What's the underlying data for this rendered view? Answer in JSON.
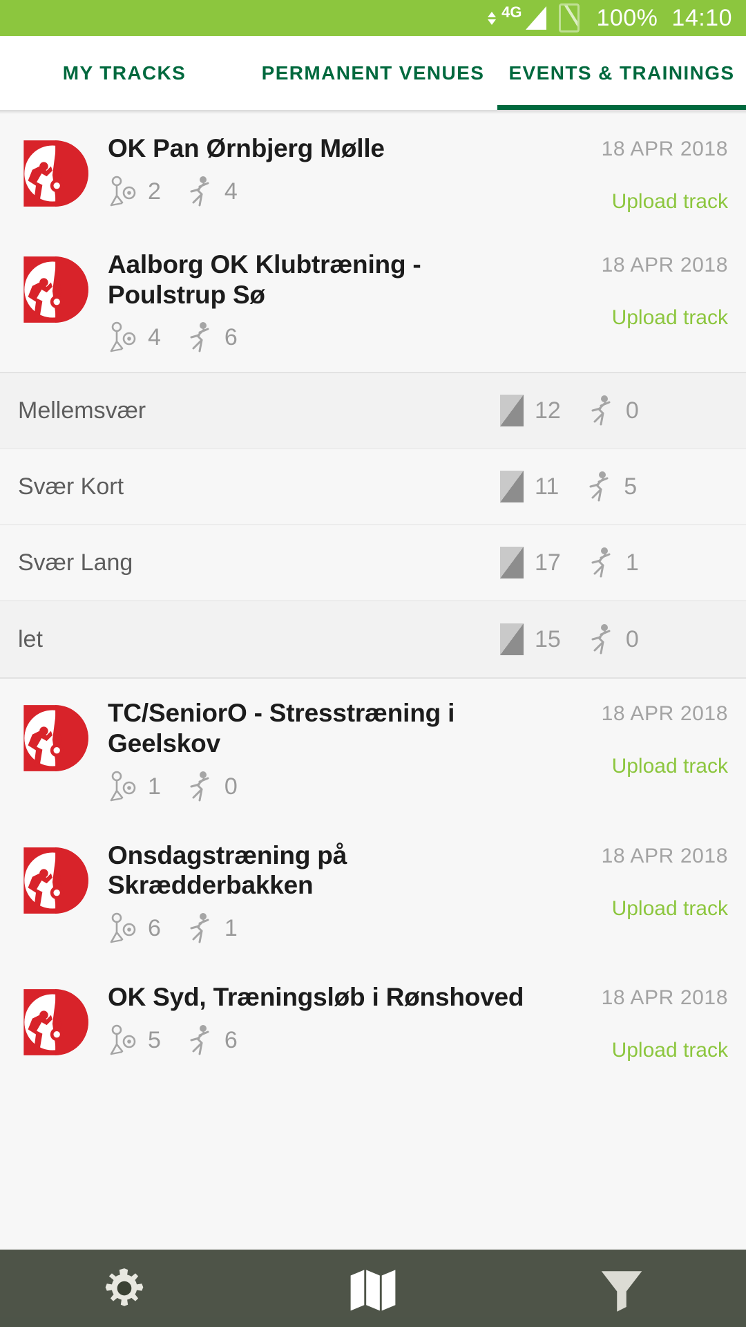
{
  "statusbar": {
    "network_label": "4G",
    "battery_percent": "100%",
    "time": "14:10",
    "background_color": "#8cc63e"
  },
  "tabs": [
    {
      "label": "MY TRACKS",
      "active": false
    },
    {
      "label": "PERMANENT VENUES",
      "active": false
    },
    {
      "label": "EVENTS & TRAININGS",
      "active": true
    }
  ],
  "theme": {
    "tab_color": "#00693e",
    "accent_green": "#8cc63e",
    "logo_red": "#d8232a",
    "muted_text": "#9a9a9a"
  },
  "upload_label": "Upload track",
  "events": [
    {
      "title": "OK Pan Ørnbjerg Mølle",
      "date": "18 APR 2018",
      "upload": "Upload track",
      "control_count": "2",
      "runner_count": "4"
    },
    {
      "title": "Aalborg OK Klubtræning - Poulstrup Sø",
      "date": "18 APR 2018",
      "upload": "Upload track",
      "control_count": "4",
      "runner_count": "6"
    },
    {
      "title": "TC/SeniorO - Stresstræning i Geelskov",
      "date": "18 APR 2018",
      "upload": "Upload track",
      "control_count": "1",
      "runner_count": "0"
    },
    {
      "title": "Onsdagstræning på Skrædderbakken",
      "date": "18 APR 2018",
      "upload": "Upload track",
      "control_count": "6",
      "runner_count": "1"
    },
    {
      "title": "OK Syd, Træningsløb i Rønshoved",
      "date": "18 APR 2018",
      "upload": "Upload track",
      "control_count": "5",
      "runner_count": "6"
    }
  ],
  "courses": [
    {
      "name": "Mellemsvær",
      "controls": "12",
      "runners": "0"
    },
    {
      "name": "Svær Kort",
      "controls": "11",
      "runners": "5"
    },
    {
      "name": "Svær Lang",
      "controls": "17",
      "runners": "1"
    },
    {
      "name": "let",
      "controls": "15",
      "runners": "0"
    }
  ],
  "bottom_nav": [
    {
      "icon": "gear-icon"
    },
    {
      "icon": "map-icon"
    },
    {
      "icon": "filter-funnel-icon"
    }
  ]
}
